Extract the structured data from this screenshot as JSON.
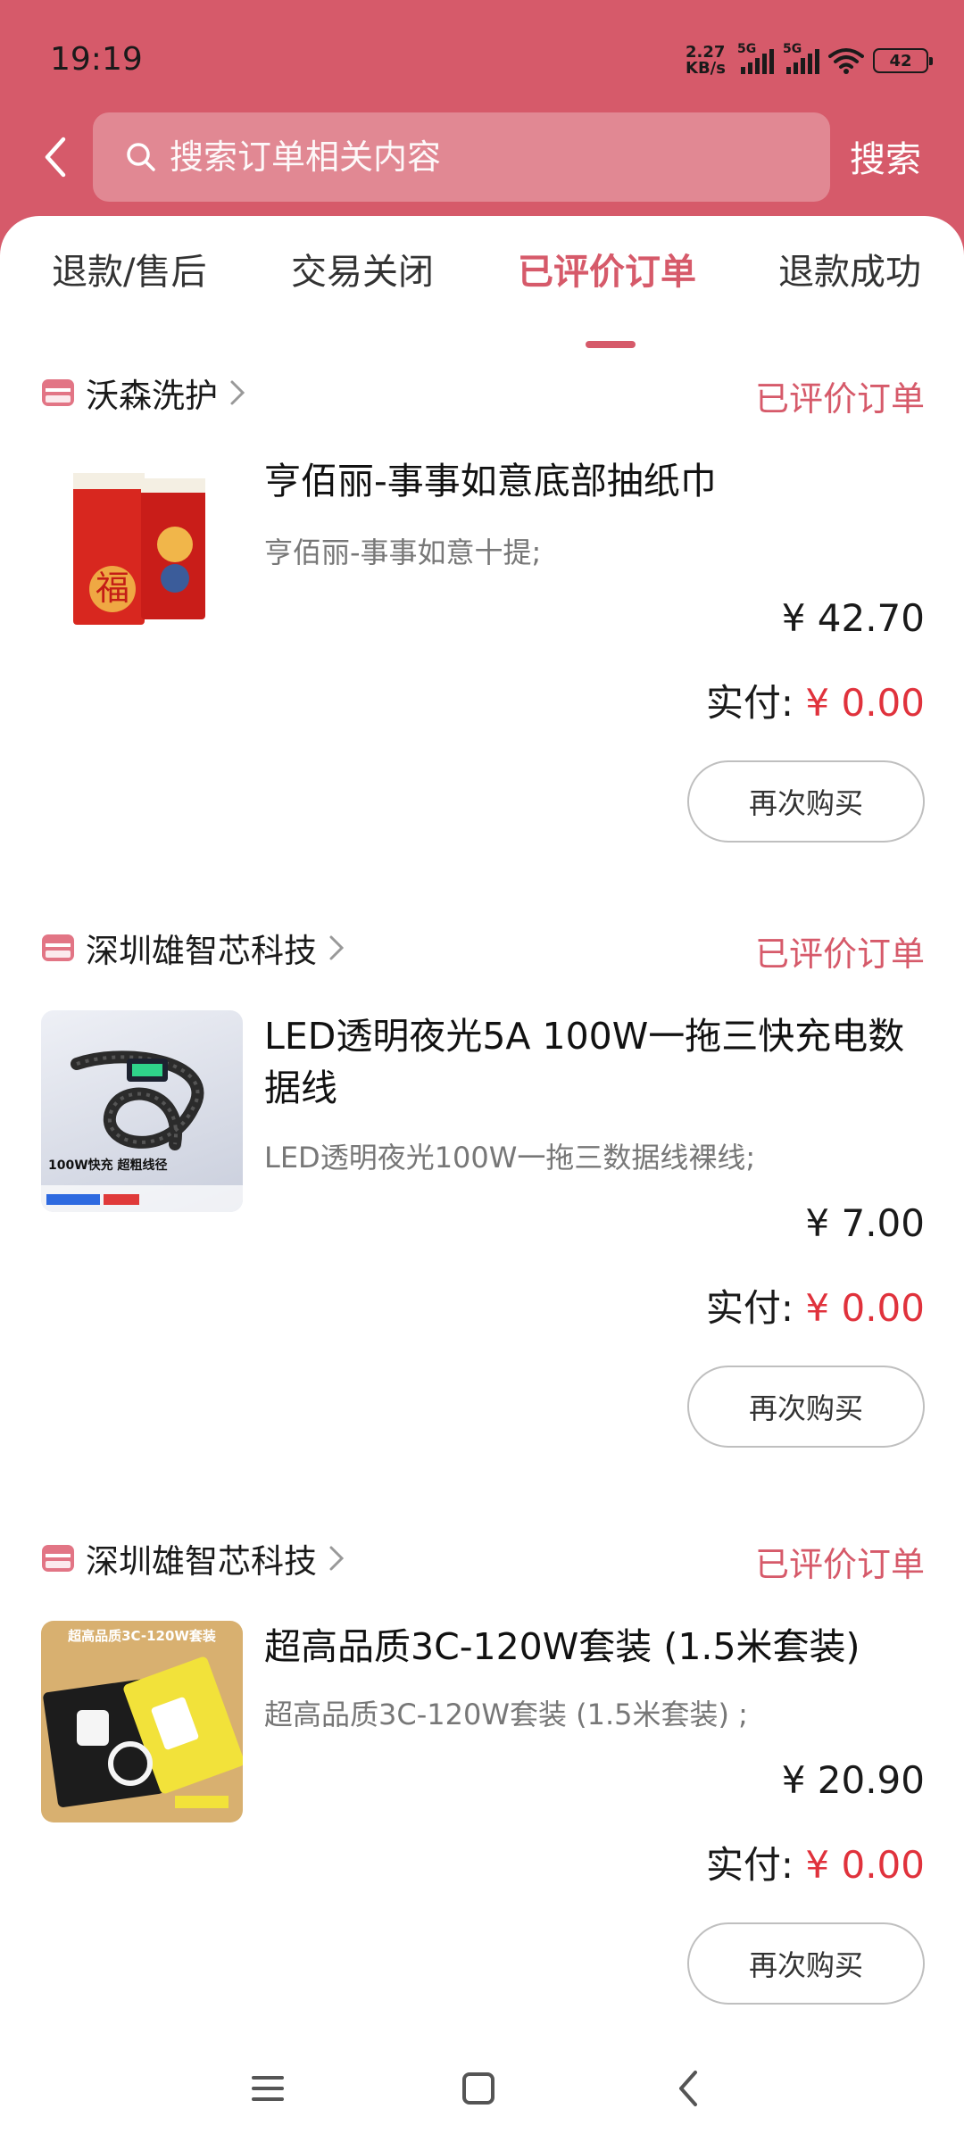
{
  "status_bar": {
    "time": "19:19",
    "net_speed_top": "2.27",
    "net_speed_bottom": "KB/s",
    "sim1": "5G",
    "sim2": "5G",
    "battery": "42"
  },
  "search": {
    "placeholder": "搜索订单相关内容",
    "button_label": "搜索"
  },
  "tabs": [
    {
      "label": "退款/售后",
      "active": false
    },
    {
      "label": "交易关闭",
      "active": false
    },
    {
      "label": "已评价订单",
      "active": true
    },
    {
      "label": "退款成功",
      "active": false
    }
  ],
  "orders": [
    {
      "shop": "沃森洗护",
      "status": "已评价订单",
      "title": "亨佰丽-事事如意底部抽纸巾",
      "sku": "亨佰丽-事事如意十提;",
      "price": "¥ 42.70",
      "paid_label": "实付:",
      "paid_amount": "¥ 0.00",
      "rebuy": "再次购买",
      "thumb_text": "福"
    },
    {
      "shop": "深圳雄智芯科技",
      "status": "已评价订单",
      "title": "LED透明夜光5A 100W一拖三快充电数据线",
      "sku": "LED透明夜光100W一拖三数据线裸线;",
      "price": "¥ 7.00",
      "paid_label": "实付:",
      "paid_amount": "¥ 0.00",
      "rebuy": "再次购买",
      "thumb_text": "100W快充 超粗线径"
    },
    {
      "shop": "深圳雄智芯科技",
      "status": "已评价订单",
      "title": "超高品质3C-120W套装 (1.5米套装)",
      "sku": "超高品质3C-120W套装 (1.5米套装) ;",
      "price": "¥ 20.90",
      "paid_label": "实付:",
      "paid_amount": "¥ 0.00",
      "rebuy": "再次购买",
      "thumb_text": "超高品质3C-120W套装"
    }
  ],
  "colors": {
    "brand": "#d65a6a",
    "paid_amount": "#e0323c"
  },
  "nav_icons": [
    "menu-icon",
    "home-icon",
    "back-icon"
  ]
}
